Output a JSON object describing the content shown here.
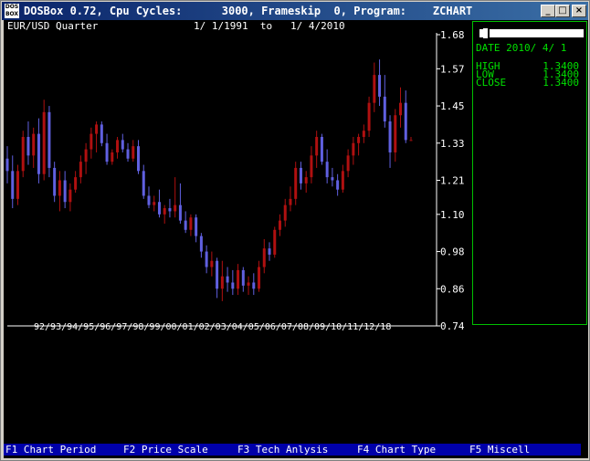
{
  "window": {
    "title": "DOSBox 0.72, Cpu Cycles:      3000, Frameskip  0, Program:    ZCHART",
    "icon_top": "DOS",
    "icon_bottom": "BOX",
    "minimize_label": "_",
    "maximize_label": "□",
    "close_label": "×"
  },
  "chart_header": {
    "symbol": "EUR/USD Quarter",
    "range": "1/ 1/1991  to   1/ 4/2010"
  },
  "info_panel": {
    "date_label": "DATE",
    "date_value": "2010/ 4/ 1",
    "high_label": "HIGH",
    "high_value": "1.3400",
    "low_label": "LOW",
    "low_value": "1.3400",
    "close_label": "CLOSE",
    "close_value": "1.3400"
  },
  "function_keys": [
    {
      "label": "F1 Chart Period"
    },
    {
      "label": "F2 Price Scale"
    },
    {
      "label": "F3 Tech Anlysis"
    },
    {
      "label": "F4 Chart Type"
    },
    {
      "label": "F5 Miscell"
    }
  ],
  "chart_data": {
    "type": "candlestick",
    "title": "EUR/USD Quarter",
    "ylim": [
      0.74,
      1.68
    ],
    "y_ticks": [
      "1.68",
      "1.57",
      "1.45",
      "1.33",
      "1.21",
      "1.10",
      "0.98",
      "0.86",
      "0.74"
    ],
    "x_tick_labels": "92/93/94/95/96/97/98/99/00/01/02/03/04/05/06/07/08/09/10/11/12/18",
    "colors": {
      "up": "#b01010",
      "down": "#6060e0",
      "axis": "#ffffff"
    },
    "candles": [
      {
        "o": 1.28,
        "h": 1.32,
        "l": 1.2,
        "c": 1.24
      },
      {
        "o": 1.24,
        "h": 1.29,
        "l": 1.12,
        "c": 1.15
      },
      {
        "o": 1.15,
        "h": 1.26,
        "l": 1.13,
        "c": 1.24
      },
      {
        "o": 1.24,
        "h": 1.37,
        "l": 1.22,
        "c": 1.35
      },
      {
        "o": 1.35,
        "h": 1.4,
        "l": 1.26,
        "c": 1.29
      },
      {
        "o": 1.29,
        "h": 1.38,
        "l": 1.25,
        "c": 1.36
      },
      {
        "o": 1.36,
        "h": 1.41,
        "l": 1.2,
        "c": 1.23
      },
      {
        "o": 1.23,
        "h": 1.47,
        "l": 1.21,
        "c": 1.43
      },
      {
        "o": 1.43,
        "h": 1.45,
        "l": 1.22,
        "c": 1.25
      },
      {
        "o": 1.25,
        "h": 1.27,
        "l": 1.14,
        "c": 1.16
      },
      {
        "o": 1.16,
        "h": 1.24,
        "l": 1.11,
        "c": 1.21
      },
      {
        "o": 1.21,
        "h": 1.24,
        "l": 1.12,
        "c": 1.14
      },
      {
        "o": 1.14,
        "h": 1.2,
        "l": 1.11,
        "c": 1.18
      },
      {
        "o": 1.18,
        "h": 1.24,
        "l": 1.17,
        "c": 1.22
      },
      {
        "o": 1.22,
        "h": 1.29,
        "l": 1.2,
        "c": 1.27
      },
      {
        "o": 1.27,
        "h": 1.33,
        "l": 1.23,
        "c": 1.31
      },
      {
        "o": 1.31,
        "h": 1.38,
        "l": 1.28,
        "c": 1.36
      },
      {
        "o": 1.36,
        "h": 1.4,
        "l": 1.3,
        "c": 1.39
      },
      {
        "o": 1.39,
        "h": 1.4,
        "l": 1.32,
        "c": 1.33
      },
      {
        "o": 1.33,
        "h": 1.36,
        "l": 1.26,
        "c": 1.27
      },
      {
        "o": 1.27,
        "h": 1.31,
        "l": 1.26,
        "c": 1.3
      },
      {
        "o": 1.3,
        "h": 1.35,
        "l": 1.28,
        "c": 1.34
      },
      {
        "o": 1.34,
        "h": 1.36,
        "l": 1.3,
        "c": 1.31
      },
      {
        "o": 1.31,
        "h": 1.33,
        "l": 1.27,
        "c": 1.28
      },
      {
        "o": 1.28,
        "h": 1.34,
        "l": 1.27,
        "c": 1.32
      },
      {
        "o": 1.32,
        "h": 1.34,
        "l": 1.23,
        "c": 1.24
      },
      {
        "o": 1.24,
        "h": 1.26,
        "l": 1.15,
        "c": 1.16
      },
      {
        "o": 1.16,
        "h": 1.19,
        "l": 1.12,
        "c": 1.13
      },
      {
        "o": 1.13,
        "h": 1.16,
        "l": 1.11,
        "c": 1.14
      },
      {
        "o": 1.14,
        "h": 1.18,
        "l": 1.09,
        "c": 1.1
      },
      {
        "o": 1.1,
        "h": 1.13,
        "l": 1.07,
        "c": 1.12
      },
      {
        "o": 1.12,
        "h": 1.15,
        "l": 1.09,
        "c": 1.11
      },
      {
        "o": 1.11,
        "h": 1.22,
        "l": 1.09,
        "c": 1.13
      },
      {
        "o": 1.13,
        "h": 1.2,
        "l": 1.07,
        "c": 1.08
      },
      {
        "o": 1.08,
        "h": 1.11,
        "l": 1.04,
        "c": 1.05
      },
      {
        "o": 1.05,
        "h": 1.1,
        "l": 1.03,
        "c": 1.09
      },
      {
        "o": 1.09,
        "h": 1.1,
        "l": 1.01,
        "c": 1.03
      },
      {
        "o": 1.03,
        "h": 1.04,
        "l": 0.96,
        "c": 0.98
      },
      {
        "o": 0.98,
        "h": 1.0,
        "l": 0.91,
        "c": 0.93
      },
      {
        "o": 0.93,
        "h": 0.98,
        "l": 0.9,
        "c": 0.95
      },
      {
        "o": 0.95,
        "h": 0.96,
        "l": 0.83,
        "c": 0.86
      },
      {
        "o": 0.86,
        "h": 0.95,
        "l": 0.82,
        "c": 0.9
      },
      {
        "o": 0.9,
        "h": 0.93,
        "l": 0.85,
        "c": 0.88
      },
      {
        "o": 0.88,
        "h": 0.92,
        "l": 0.84,
        "c": 0.86
      },
      {
        "o": 0.86,
        "h": 0.94,
        "l": 0.84,
        "c": 0.92
      },
      {
        "o": 0.92,
        "h": 0.93,
        "l": 0.85,
        "c": 0.87
      },
      {
        "o": 0.87,
        "h": 0.9,
        "l": 0.84,
        "c": 0.88
      },
      {
        "o": 0.88,
        "h": 0.91,
        "l": 0.84,
        "c": 0.86
      },
      {
        "o": 0.86,
        "h": 0.95,
        "l": 0.85,
        "c": 0.93
      },
      {
        "o": 0.93,
        "h": 1.02,
        "l": 0.91,
        "c": 0.99
      },
      {
        "o": 0.99,
        "h": 1.01,
        "l": 0.95,
        "c": 0.97
      },
      {
        "o": 0.97,
        "h": 1.06,
        "l": 0.96,
        "c": 1.05
      },
      {
        "o": 1.05,
        "h": 1.1,
        "l": 1.03,
        "c": 1.08
      },
      {
        "o": 1.08,
        "h": 1.15,
        "l": 1.06,
        "c": 1.13
      },
      {
        "o": 1.13,
        "h": 1.19,
        "l": 1.11,
        "c": 1.15
      },
      {
        "o": 1.15,
        "h": 1.27,
        "l": 1.13,
        "c": 1.25
      },
      {
        "o": 1.25,
        "h": 1.27,
        "l": 1.18,
        "c": 1.2
      },
      {
        "o": 1.2,
        "h": 1.24,
        "l": 1.17,
        "c": 1.22
      },
      {
        "o": 1.22,
        "h": 1.32,
        "l": 1.2,
        "c": 1.29
      },
      {
        "o": 1.29,
        "h": 1.37,
        "l": 1.25,
        "c": 1.35
      },
      {
        "o": 1.35,
        "h": 1.36,
        "l": 1.26,
        "c": 1.27
      },
      {
        "o": 1.27,
        "h": 1.31,
        "l": 1.2,
        "c": 1.22
      },
      {
        "o": 1.22,
        "h": 1.25,
        "l": 1.19,
        "c": 1.21
      },
      {
        "o": 1.21,
        "h": 1.23,
        "l": 1.16,
        "c": 1.18
      },
      {
        "o": 1.18,
        "h": 1.26,
        "l": 1.17,
        "c": 1.24
      },
      {
        "o": 1.24,
        "h": 1.31,
        "l": 1.22,
        "c": 1.29
      },
      {
        "o": 1.29,
        "h": 1.35,
        "l": 1.26,
        "c": 1.33
      },
      {
        "o": 1.33,
        "h": 1.36,
        "l": 1.29,
        "c": 1.35
      },
      {
        "o": 1.35,
        "h": 1.39,
        "l": 1.33,
        "c": 1.37
      },
      {
        "o": 1.37,
        "h": 1.48,
        "l": 1.35,
        "c": 1.46
      },
      {
        "o": 1.46,
        "h": 1.59,
        "l": 1.43,
        "c": 1.55
      },
      {
        "o": 1.55,
        "h": 1.6,
        "l": 1.45,
        "c": 1.48
      },
      {
        "o": 1.48,
        "h": 1.55,
        "l": 1.38,
        "c": 1.4
      },
      {
        "o": 1.4,
        "h": 1.42,
        "l": 1.25,
        "c": 1.3
      },
      {
        "o": 1.3,
        "h": 1.44,
        "l": 1.27,
        "c": 1.42
      },
      {
        "o": 1.42,
        "h": 1.51,
        "l": 1.38,
        "c": 1.46
      },
      {
        "o": 1.46,
        "h": 1.5,
        "l": 1.33,
        "c": 1.34
      },
      {
        "o": 1.34,
        "h": 1.35,
        "l": 1.34,
        "c": 1.34
      }
    ]
  }
}
